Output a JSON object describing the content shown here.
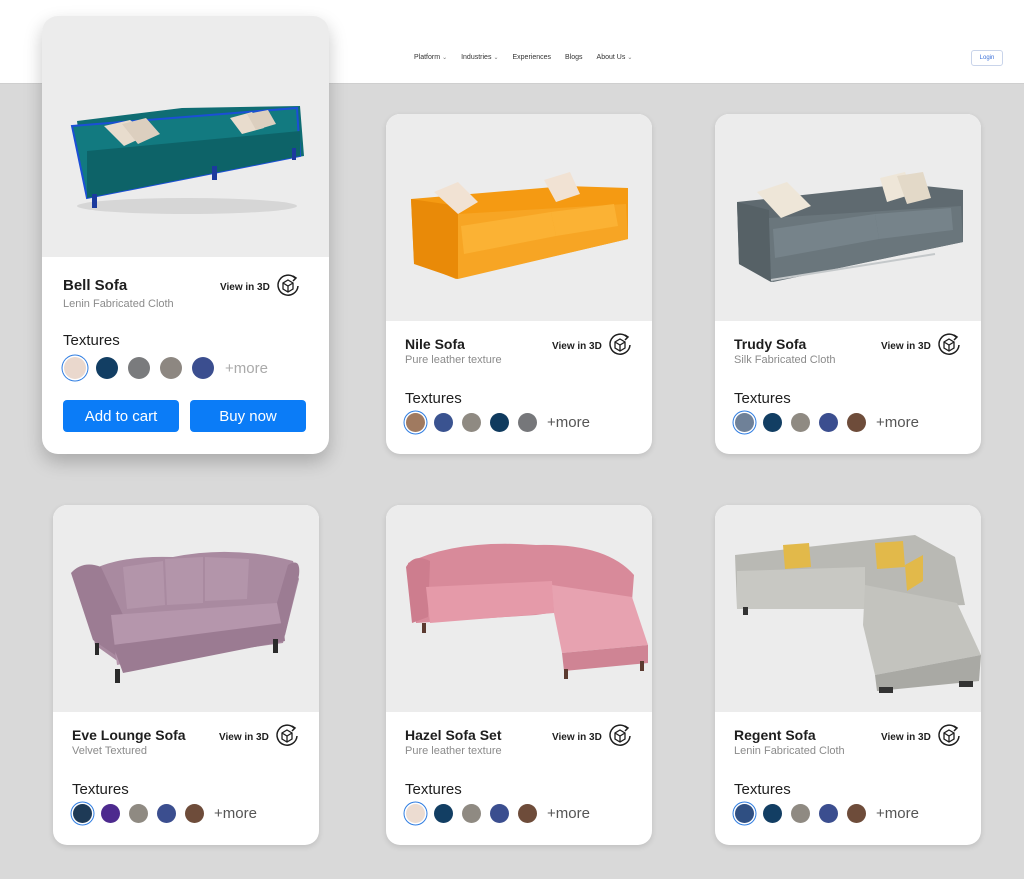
{
  "nav": {
    "items": [
      {
        "label": "Platform",
        "dropdown": true
      },
      {
        "label": "Industries",
        "dropdown": true
      },
      {
        "label": "Experiences",
        "dropdown": false
      },
      {
        "label": "Blogs",
        "dropdown": false
      },
      {
        "label": "About Us",
        "dropdown": true
      }
    ],
    "login_label": "Login"
  },
  "common": {
    "view_3d_label": "View in 3D",
    "textures_label": "Textures",
    "more_label": "+more",
    "add_to_cart_label": "Add to cart",
    "buy_now_label": "Buy now"
  },
  "featured": {
    "name": "Bell Sofa",
    "material": "Lenin Fabricated Cloth",
    "swatches": [
      "#ead8cd",
      "#123e63",
      "#7a7b7d",
      "#8d8781",
      "#3b4e8f"
    ]
  },
  "products": [
    {
      "name": "Nile Sofa",
      "material": "Pure leather texture",
      "swatches": [
        "#a07a60",
        "#3a5390",
        "#8f8a82",
        "#0f3a5e",
        "#76777a"
      ]
    },
    {
      "name": "Trudy Sofa",
      "material": "Silk Fabricated Cloth",
      "swatches": [
        "#6f8198",
        "#123e63",
        "#8f8a82",
        "#3b4e8f",
        "#6e4c3a"
      ]
    },
    {
      "name": "Eve Lounge Sofa",
      "material": "Velvet Textured",
      "swatches": [
        "#1e3a56",
        "#4d2a8e",
        "#8f8a82",
        "#3b4e8f",
        "#6e4c3a"
      ]
    },
    {
      "name": "Hazel Sofa Set",
      "material": "Pure leather texture",
      "swatches": [
        "#ecdcd1",
        "#123e63",
        "#8f8a82",
        "#3b4e8f",
        "#6e4c3a"
      ]
    },
    {
      "name": "Regent Sofa",
      "material": "Lenin Fabricated Cloth",
      "swatches": [
        "#2f4f82",
        "#123e63",
        "#8f8a82",
        "#3b4e8f",
        "#6e4c3a"
      ]
    }
  ],
  "colors": {
    "accent": "#0b7cf7",
    "page_bg": "#d9d9d9",
    "image_bg": "#ececec"
  }
}
